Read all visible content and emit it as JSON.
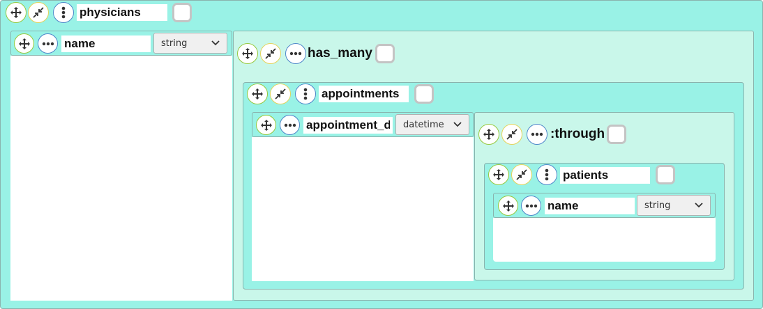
{
  "root_table": {
    "name": "physicians"
  },
  "root_fields": [
    {
      "name": "name",
      "type": "string"
    }
  ],
  "has_many": {
    "label": "has_many",
    "target": {
      "name": "appointments",
      "fields": [
        {
          "name": "appointment_date",
          "type": "datetime"
        }
      ],
      "through": {
        "label": ":through",
        "target": {
          "name": "patients",
          "fields": [
            {
              "name": "name",
              "type": "string"
            }
          ]
        }
      }
    }
  },
  "colors": {
    "table_bg": "#99f2e6",
    "association_bg": "#c9f7ea",
    "move_ring": "#96c83e",
    "collapse_ring": "#e5d35a",
    "menu_ring": "#4e87c9"
  },
  "icons": {
    "move": "move-arrows-icon",
    "collapse": "collapse-arrows-icon",
    "table_menu": "vertical-dots-icon",
    "field_menu": "horizontal-dots-icon",
    "dropdown": "chevron-down-icon"
  }
}
